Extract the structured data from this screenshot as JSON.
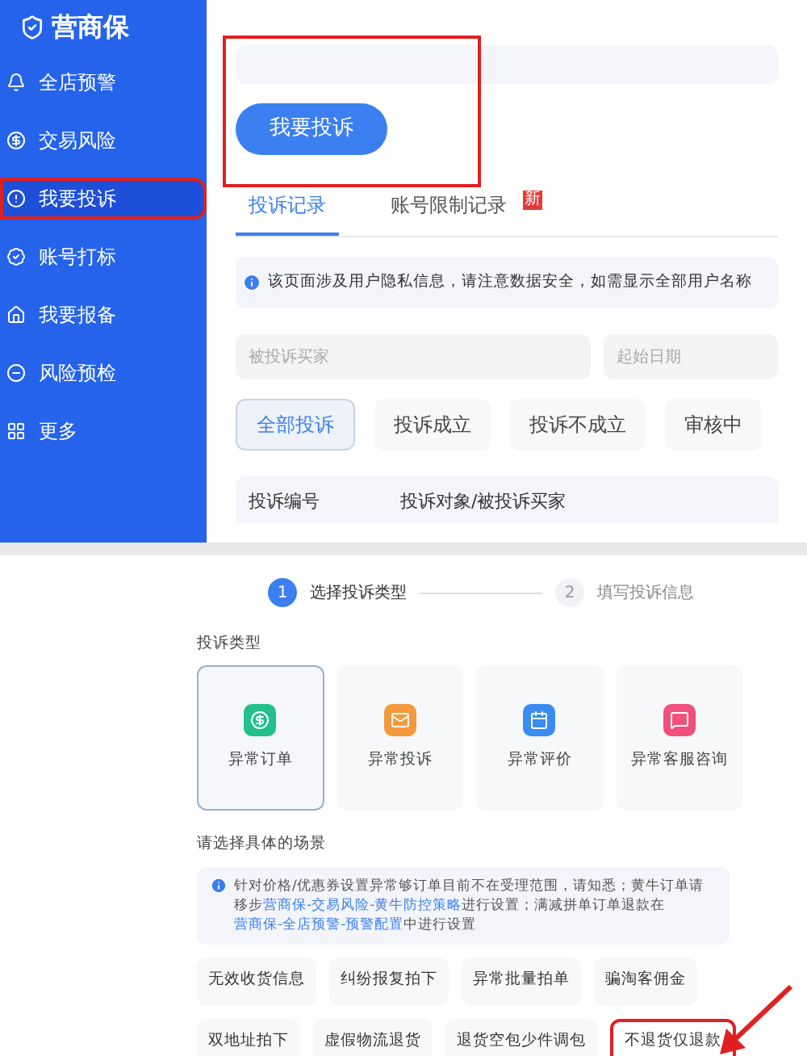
{
  "logo": {
    "text": "营商保"
  },
  "sidebar": {
    "items": [
      {
        "label": "全店预警",
        "selected": false,
        "highlighted": false
      },
      {
        "label": "交易风险",
        "selected": false,
        "highlighted": false
      },
      {
        "label": "我要投诉",
        "selected": true,
        "highlighted": true
      },
      {
        "label": "账号打标",
        "selected": false,
        "highlighted": false
      },
      {
        "label": "我要报备",
        "selected": false,
        "highlighted": false
      },
      {
        "label": "风险预检",
        "selected": false,
        "highlighted": false
      },
      {
        "label": "更多",
        "selected": false,
        "highlighted": false
      }
    ]
  },
  "complaint_button": {
    "label": "我要投诉",
    "highlighted": true
  },
  "tabs": [
    {
      "label": "投诉记录",
      "selected": true
    },
    {
      "label": "账号限制记录",
      "selected": false,
      "badge": "新"
    }
  ],
  "notice": "该页面涉及用户隐私信息，请注意数据安全，如需显示全部用户名称",
  "filters": {
    "buyer": {
      "placeholder": "被投诉买家"
    },
    "start_date": {
      "placeholder": "起始日期"
    }
  },
  "status_filters": [
    {
      "label": "全部投诉",
      "selected": true
    },
    {
      "label": "投诉成立",
      "selected": false
    },
    {
      "label": "投诉不成立",
      "selected": false
    },
    {
      "label": "审核中",
      "selected": false
    }
  ],
  "table": {
    "columns": [
      "投诉编号",
      "投诉对象/被投诉买家"
    ]
  },
  "steps": [
    {
      "number": "1",
      "label": "选择投诉类型",
      "active": true
    },
    {
      "number": "2",
      "label": "填写投诉信息",
      "active": false
    }
  ],
  "type_section": {
    "title": "投诉类型",
    "types": [
      {
        "label": "异常订单",
        "selected": true,
        "color": "#22c08a"
      },
      {
        "label": "异常投诉",
        "selected": false,
        "color": "#f59a3c"
      },
      {
        "label": "异常评价",
        "selected": false,
        "color": "#3b8cf0"
      },
      {
        "label": "异常客服咨询",
        "selected": false,
        "color": "#f0507a"
      }
    ]
  },
  "scenario_section": {
    "title": "请选择具体的场景",
    "notice": [
      {
        "kind": "text",
        "text": "针对价格/优惠券设置异常够订单目前不在受理范围，请知悉；黄牛订单请移步"
      },
      {
        "kind": "link",
        "text": "营商保-交易风险-黄牛防控策略"
      },
      {
        "kind": "text",
        "text": "进行设置；满减拼单订单退款在"
      },
      {
        "kind": "link",
        "text": "营商保-全店预警-预警配置"
      },
      {
        "kind": "text",
        "text": "中进行设置"
      }
    ],
    "scenarios": [
      [
        {
          "label": "无效收货信息",
          "highlighted": false
        },
        {
          "label": "纠纷报复拍下",
          "highlighted": false
        },
        {
          "label": "异常批量拍单",
          "highlighted": false
        },
        {
          "label": "骗淘客佣金",
          "highlighted": false
        }
      ],
      [
        {
          "label": "双地址拍下",
          "highlighted": false
        },
        {
          "label": "虚假物流退货",
          "highlighted": false
        },
        {
          "label": "退货空包少件调包",
          "highlighted": false
        },
        {
          "label": "不退货仅退款",
          "highlighted": true
        }
      ]
    ]
  }
}
